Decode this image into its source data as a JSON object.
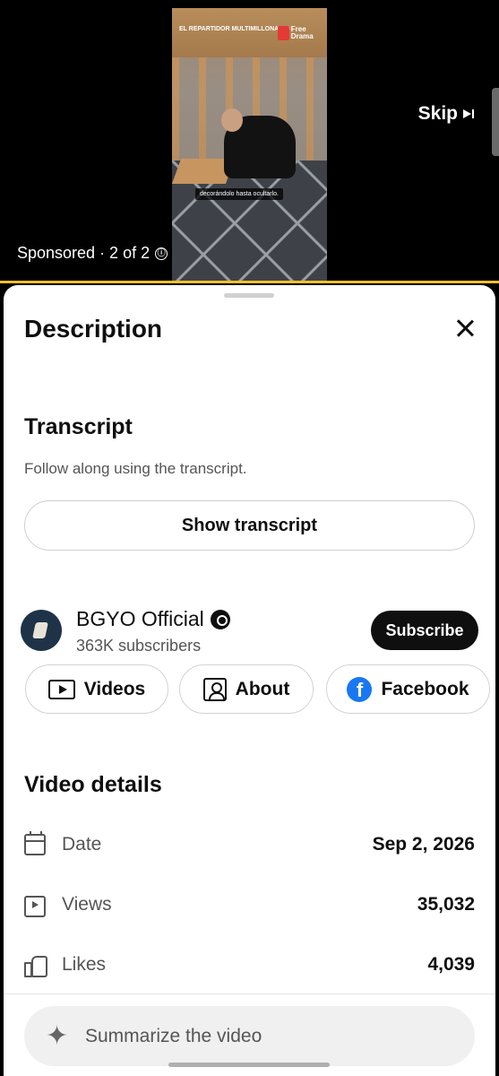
{
  "video": {
    "clip_brand_text": "El Repartidor MULTIMILLONARIO",
    "clip_logo_text": "Free Drama",
    "clip_caption": "decorándolo hasta ocultarlo."
  },
  "ad": {
    "skip_label": "Skip",
    "sponsored_text": "Sponsored · 2 of 2",
    "info_icon": "ⓘ",
    "progress_color": "#f2c12e"
  },
  "sheet": {
    "title": "Description",
    "close_icon": "close-icon"
  },
  "transcript": {
    "title": "Transcript",
    "description": "Follow along using the transcript.",
    "button_label": "Show transcript"
  },
  "channel": {
    "name": "BGYO Official",
    "subscribers": "363K subscribers",
    "subscribe_label": "Subscribe",
    "links": [
      {
        "label": "Videos",
        "icon": "videos-icon"
      },
      {
        "label": "About",
        "icon": "about-icon"
      },
      {
        "label": "Facebook",
        "icon": "facebook-icon"
      }
    ]
  },
  "details": {
    "title": "Video details",
    "rows": [
      {
        "label": "Date",
        "value": "Sep 2, 2026",
        "icon": "calendar-icon"
      },
      {
        "label": "Views",
        "value": "35,032",
        "icon": "views-icon"
      },
      {
        "label": "Likes",
        "value": "4,039",
        "icon": "likes-icon"
      }
    ]
  },
  "summarize": {
    "label": "Summarize the video",
    "icon": "sparkle-icon"
  }
}
